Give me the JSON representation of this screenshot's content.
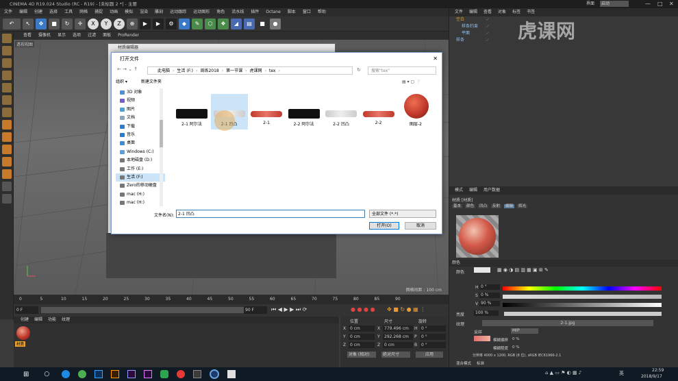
{
  "window": {
    "title": "CINEMA 4D R19.024 Studio (RC - R19) - [未标题 2 *] - 主要"
  },
  "menu": [
    "文件",
    "编辑",
    "创建",
    "选择",
    "工具",
    "网格",
    "捕捉",
    "动画",
    "模拟",
    "渲染",
    "雕刻",
    "运动跟踪",
    "运动图形",
    "角色",
    "流水线",
    "插件",
    "Octane",
    "脚本",
    "窗口",
    "帮助"
  ],
  "viewport": {
    "menu": [
      "查看",
      "摄像机",
      "显示",
      "选项",
      "过滤",
      "面板",
      "ProRender"
    ],
    "label": "透视视图",
    "grid_info": "网格间距 : 100 cm"
  },
  "toolbar": {
    "axes": [
      "X",
      "Y",
      "Z"
    ]
  },
  "timeline": {
    "ticks": [
      "0",
      "5",
      "10",
      "15",
      "20",
      "25",
      "30",
      "35",
      "40",
      "45",
      "50",
      "55",
      "60",
      "65",
      "70",
      "75",
      "80",
      "85",
      "90"
    ],
    "start": "0 F",
    "field": "0 F",
    "end": "90 F",
    "end2": "90 F"
  },
  "material_manager": {
    "menu": [
      "创建",
      "编辑",
      "功能",
      "纹理"
    ],
    "material_name": "材质"
  },
  "coords": {
    "headers": [
      "位置",
      "尺寸",
      "旋转"
    ],
    "rows": [
      {
        "axis": "X",
        "pos": "0 cm",
        "axis2": "X",
        "size": "779.496 cm",
        "rot_axis": "H",
        "rot": "0 °"
      },
      {
        "axis": "Y",
        "pos": "0 cm",
        "axis2": "Y",
        "size": "292.268 cm",
        "rot_axis": "P",
        "rot": "0 °"
      },
      {
        "axis": "Z",
        "pos": "0 cm",
        "axis2": "Z",
        "size": "0 cm",
        "rot_axis": "B",
        "rot": "0 °"
      }
    ],
    "mode": "对象 (相对)",
    "size_mode": "绝对尺寸",
    "apply": "应用"
  },
  "object_manager": {
    "tabs": [
      "文件",
      "编辑",
      "查看",
      "对象",
      "标签",
      "书签"
    ],
    "objects": [
      "空白",
      "样条约束",
      "平面",
      "样条"
    ]
  },
  "attribute": {
    "tabs": [
      "模式",
      "编辑",
      "用户数据"
    ],
    "title": "材质 [材质]",
    "subtabs": [
      "基本",
      "颜色",
      "凹凸",
      "反射",
      "编辑",
      "辉光"
    ],
    "section": "颜色",
    "color_label": "颜色",
    "H": "0 °",
    "S": "0 %",
    "V": "90 %",
    "brightness_label": "亮度",
    "brightness": "100 %",
    "texture_label": "纹理",
    "texture_file": "2-1.jpg",
    "blend_mode_label": "采样",
    "blend_mode": "MIP",
    "blur_offset_label": "模糊偏移",
    "blur_offset": "0 %",
    "blur_scale_label": "模糊程度",
    "blur_scale": "0 %",
    "resolution": "分辨率 4000 x 1200, RGB (8 位), sRGB IEC61966-2.1",
    "mix_label": "混合模式",
    "mix_value": "标准"
  },
  "layout_label": "界面",
  "layout_value": "启动",
  "mat_editor": {
    "title": "材质编辑器"
  },
  "file_dialog": {
    "title": "打开文件",
    "path": [
      "此电脑",
      "生活 (F:)",
      "周练2018",
      "第一节课",
      "虎课网",
      "tex"
    ],
    "search_placeholder": "搜索\"tex\"",
    "organize": "组织 ▾",
    "new_folder": "新建文件夹",
    "nav": [
      {
        "label": "3D 对象",
        "c": "#4a8fd8"
      },
      {
        "label": "视频",
        "c": "#7a5cc7"
      },
      {
        "label": "图片",
        "c": "#4aa0d8"
      },
      {
        "label": "文档",
        "c": "#8aa4c0"
      },
      {
        "label": "下载",
        "c": "#2b7bd0"
      },
      {
        "label": "音乐",
        "c": "#2b7bd0"
      },
      {
        "label": "桌面",
        "c": "#3c8dd8"
      },
      {
        "label": "Windows (C:)",
        "c": "#5aa0e0"
      },
      {
        "label": "本地磁盘 (D:)",
        "c": "#777"
      },
      {
        "label": "工作 (E:)",
        "c": "#777"
      },
      {
        "label": "生活 (F:)",
        "c": "#777"
      },
      {
        "label": "Zero的移动硬盘",
        "c": "#777"
      },
      {
        "label": "mac (H:)",
        "c": "#777"
      },
      {
        "label": "mac (H:)",
        "c": "#777"
      }
    ],
    "files": [
      {
        "label": "2-1 阿尔法",
        "type": "alpha"
      },
      {
        "label": "2-1 凹凸",
        "type": "bump"
      },
      {
        "label": "2-1",
        "type": "color"
      },
      {
        "label": "2-2 阿尔法",
        "type": "alpha"
      },
      {
        "label": "2-2 凹凸",
        "type": "bump"
      },
      {
        "label": "2-2",
        "type": "color"
      },
      {
        "label": "图层-2",
        "type": "apple"
      }
    ],
    "filename_label": "文件名(N):",
    "filename": "2-1 凹凸",
    "filetype": "全部文件 (*.*)",
    "open": "打开(O)",
    "cancel": "取消"
  },
  "taskbar": {
    "time": "22:59",
    "date": "2018/9/17",
    "ime": "英"
  },
  "watermark": "虎课网"
}
